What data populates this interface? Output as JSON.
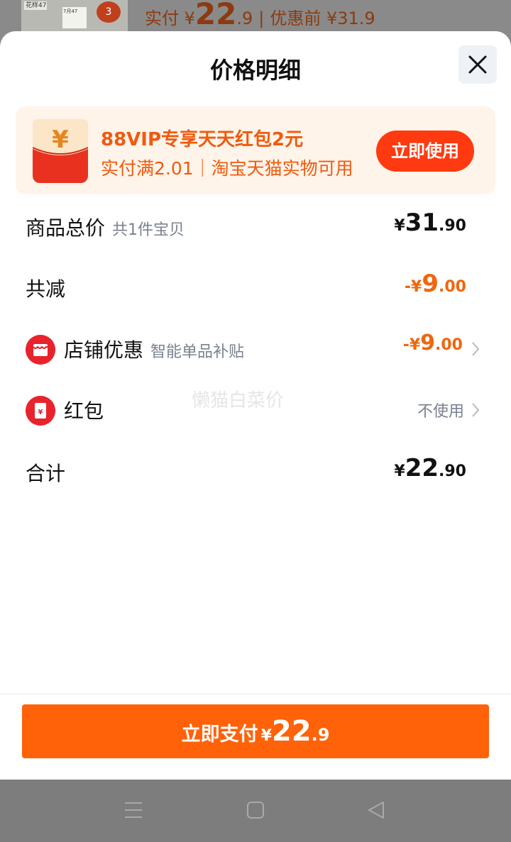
{
  "background": {
    "thumb_text_1": "花样47",
    "thumb_text_2": "7月47",
    "badge": "3",
    "price_prefix": "实付 ¥",
    "price_big": "22",
    "price_dec": ".9",
    "orig_label": "优惠前 ¥31.9"
  },
  "sheet": {
    "title": "价格明细",
    "close_icon": "close-icon"
  },
  "promo": {
    "envelope_icon": "red-envelope-icon",
    "envelope_symbol": "¥",
    "title": "88VIP专享天天红包2元",
    "subtitle": "实付满2.01｜淘宝天猫实物可用",
    "button": "立即使用"
  },
  "rows": {
    "total": {
      "label": "商品总价",
      "hint": "共1件宝贝",
      "currency": "¥",
      "int": "31",
      "dec": ".90"
    },
    "reduce": {
      "label": "共减",
      "currency": "-¥",
      "int": "9",
      "dec": ".00"
    },
    "store": {
      "icon": "store-icon",
      "label": "店铺优惠",
      "hint": "智能单品补贴",
      "currency": "-¥",
      "int": "9",
      "dec": ".00"
    },
    "redpacket": {
      "icon": "red-packet-icon",
      "label": "红包",
      "value": "不使用"
    },
    "sum": {
      "label": "合计",
      "currency": "¥",
      "int": "22",
      "dec": ".90"
    }
  },
  "watermark": "懒猫白菜价",
  "pay": {
    "text": "立即支付",
    "currency": "¥",
    "int": "22",
    "dec": ".9"
  },
  "colors": {
    "accent": "#ff6209",
    "discount": "#f0660e",
    "promo_bg": "#fff4ea",
    "promo_btn": "#ff3a10"
  }
}
